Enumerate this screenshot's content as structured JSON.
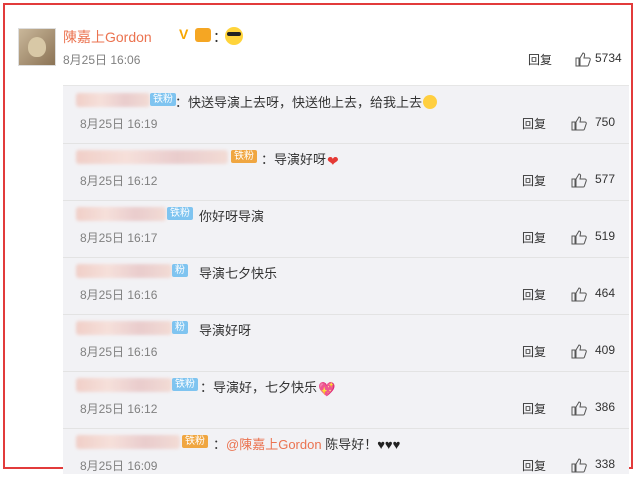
{
  "post": {
    "username": "陳嘉上Gordon",
    "verified_badge": "V",
    "colon": "：",
    "date": "8月25日 16:06",
    "reply_label": "回复",
    "likes": "5734"
  },
  "replies": [
    {
      "badge": "铁粉",
      "text": "：快送导演上去呀，快送他上去，给我上去",
      "date": "8月25日 16:19",
      "reply_label": "回复",
      "likes": "750",
      "emoji": "face"
    },
    {
      "badge": "铁粉",
      "text": "：导演好呀",
      "date": "8月25日 16:12",
      "reply_label": "回复",
      "likes": "577",
      "emoji": "heart"
    },
    {
      "badge": "铁粉",
      "text": "你好呀导演",
      "date": "8月25日 16:17",
      "reply_label": "回复",
      "likes": "519",
      "emoji": ""
    },
    {
      "badge": "粉",
      "text": "导演七夕快乐",
      "date": "8月25日 16:16",
      "reply_label": "回复",
      "likes": "464",
      "emoji": ""
    },
    {
      "badge": "粉",
      "text": "导演好呀",
      "date": "8月25日 16:16",
      "reply_label": "回复",
      "likes": "409",
      "emoji": ""
    },
    {
      "badge": "铁粉",
      "text": "：导演好，七夕快乐",
      "date": "8月25日 16:12",
      "reply_label": "回复",
      "likes": "386",
      "emoji": "pink"
    },
    {
      "badge": "铁粉",
      "mention": "@陳嘉上Gordon",
      "text": " 陈导好！",
      "hearts": "♥♥♥",
      "date": "8月25日 16:09",
      "reply_label": "回复",
      "likes": "338",
      "emoji": ""
    }
  ],
  "colors": {
    "frame": "#e23b3b",
    "username": "#eb7350",
    "badge_blue": "#7fc4f0",
    "badge_gold": "#f0a640"
  },
  "icons": [
    "avatar",
    "verified-badge-icon",
    "fan-medal-icon",
    "sunglasses-emoji-icon",
    "thumb-up-icon"
  ]
}
